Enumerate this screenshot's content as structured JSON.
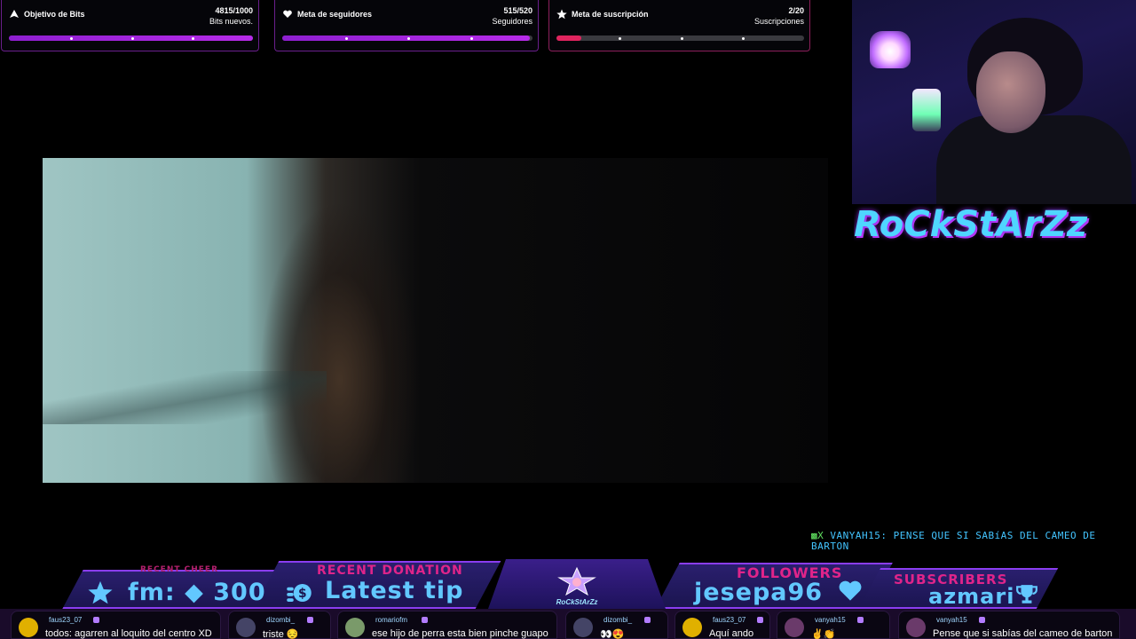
{
  "goals": {
    "bits": {
      "title": "Objetivo de Bits",
      "count": "4815/1000",
      "unit": "Bits nuevos.",
      "progress": 1.0,
      "icon": "bits-triangle-icon"
    },
    "followers": {
      "title": "Meta de seguidores",
      "count": "515/520",
      "unit": "Seguidores",
      "progress": 0.99,
      "icon": "heart-hand-icon"
    },
    "subs": {
      "title": "Meta de suscripción",
      "count": "2/20",
      "unit": "Suscripciones",
      "progress": 0.1,
      "icon": "star-icon"
    }
  },
  "channel_logo": "RoCkStArZz",
  "ticker": {
    "badge": "▩X",
    "text": "VANYAH15: PENSE QUE SI SABíAS DEL CAMEO DE BARTON"
  },
  "alerts": {
    "recent_cheer": {
      "caption": "RECENT CHEER",
      "value": "fm: ◆ 300"
    },
    "recent_donation": {
      "caption": "RECENT DONATION",
      "value": "Latest tip"
    },
    "center_mini": "RoCkStArZz",
    "followers": {
      "caption": "FOLLOWERS",
      "value": "jesepa96"
    },
    "subscribers": {
      "caption": "SUBSCRIBERS",
      "value": "azmari"
    }
  },
  "chat": [
    {
      "user": "faus23_07",
      "msg": "todos: agarren al loquito del centro XD",
      "avatar": "#e0b000"
    },
    {
      "user": "dizombi_",
      "msg": "triste 😔",
      "avatar": "#444466"
    },
    {
      "user": "romariofm",
      "msg": "ese hijo de perra esta bien pinche guapo",
      "avatar": "#7a9a6a"
    },
    {
      "user": "dizombi_",
      "msg": "👀😍",
      "avatar": "#444466"
    },
    {
      "user": "faus23_07",
      "msg": "Aquí ando",
      "avatar": "#e0b000"
    },
    {
      "user": "vanyah15",
      "msg": "✌️👏",
      "avatar": "#6a3a6a"
    },
    {
      "user": "vanyah15",
      "msg": "Pense que si sabías del cameo de barton",
      "avatar": "#6a3a6a"
    }
  ]
}
